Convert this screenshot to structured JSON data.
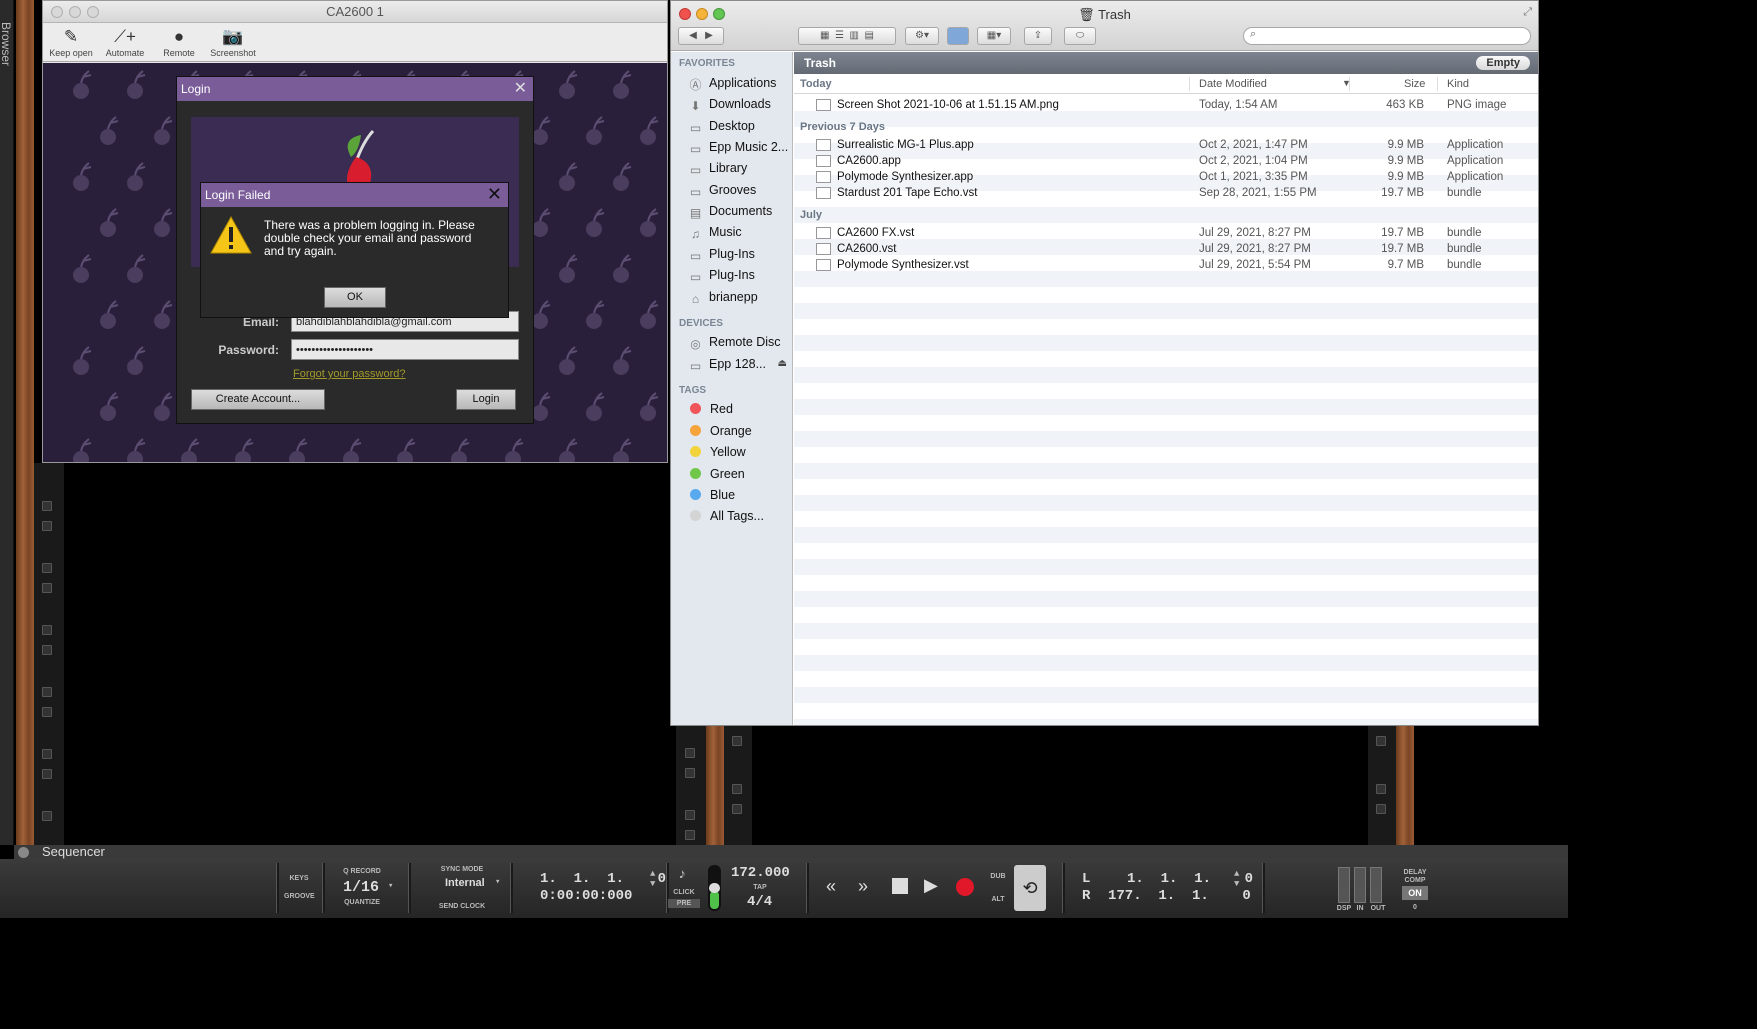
{
  "rack": {
    "browser_label": "Browser"
  },
  "ca_window": {
    "title": "CA2600 1",
    "toolbar": [
      {
        "label": "Keep open",
        "icon": "pin-icon"
      },
      {
        "label": "Automate",
        "icon": "automate-icon"
      },
      {
        "label": "Remote",
        "icon": "remote-icon"
      },
      {
        "label": "Screenshot",
        "icon": "camera-icon"
      }
    ]
  },
  "login": {
    "title": "Login",
    "email_label": "Email:",
    "email_value": "blahdiblahblahdibla@gmail.com",
    "password_label": "Password:",
    "password_value": "••••••••••••••••••••",
    "forgot": "Forgot your password?",
    "create_account": "Create Account...",
    "login_button": "Login"
  },
  "login_failed": {
    "title": "Login Failed",
    "message": "There was a problem logging in.  Please double check your email and password and try again.",
    "ok": "OK"
  },
  "finder": {
    "title": "Trash",
    "path": "Trash",
    "empty_button": "Empty",
    "sidebar": {
      "favorites_header": "FAVORITES",
      "favorites": [
        "Applications",
        "Downloads",
        "Desktop",
        "Epp Music 2...",
        "Library",
        "Grooves",
        "Documents",
        "Music",
        "Plug-Ins",
        "Plug-Ins",
        "brianepp"
      ],
      "devices_header": "DEVICES",
      "devices": [
        "Remote Disc",
        "Epp 128..."
      ],
      "tags_header": "TAGS",
      "tags": [
        {
          "name": "Red",
          "color": "#f0555a"
        },
        {
          "name": "Orange",
          "color": "#f5a33a"
        },
        {
          "name": "Yellow",
          "color": "#f2d43a"
        },
        {
          "name": "Green",
          "color": "#71c74a"
        },
        {
          "name": "Blue",
          "color": "#58a9ee"
        },
        {
          "name": "All Tags...",
          "color": "#d4d4d4"
        }
      ]
    },
    "columns": {
      "name": "Today",
      "date": "Date Modified",
      "size": "Size",
      "kind": "Kind"
    },
    "groups": [
      {
        "label": "Today",
        "rows": [
          {
            "name": "Screen Shot 2021-10-06 at 1.51.15 AM.png",
            "date": "Today, 1:54 AM",
            "size": "463 KB",
            "kind": "PNG image"
          }
        ]
      },
      {
        "label": "Previous 7 Days",
        "rows": [
          {
            "name": "Surrealistic MG-1 Plus.app",
            "date": "Oct 2, 2021, 1:47 PM",
            "size": "9.9 MB",
            "kind": "Application"
          },
          {
            "name": "CA2600.app",
            "date": "Oct 2, 2021, 1:04 PM",
            "size": "9.9 MB",
            "kind": "Application"
          },
          {
            "name": "Polymode Synthesizer.app",
            "date": "Oct 1, 2021, 3:35 PM",
            "size": "9.9 MB",
            "kind": "Application"
          },
          {
            "name": "Stardust 201 Tape Echo.vst",
            "date": "Sep 28, 2021, 1:55 PM",
            "size": "19.7 MB",
            "kind": "bundle"
          }
        ]
      },
      {
        "label": "July",
        "rows": [
          {
            "name": "CA2600 FX.vst",
            "date": "Jul 29, 2021, 8:27 PM",
            "size": "19.7 MB",
            "kind": "bundle"
          },
          {
            "name": "CA2600.vst",
            "date": "Jul 29, 2021, 8:27 PM",
            "size": "19.7 MB",
            "kind": "bundle"
          },
          {
            "name": "Polymode Synthesizer.vst",
            "date": "Jul 29, 2021, 5:54 PM",
            "size": "9.7 MB",
            "kind": "bundle"
          }
        ]
      }
    ]
  },
  "sequencer": {
    "label": "Sequencer"
  },
  "transport": {
    "keys": "KEYS",
    "groove": "GROOVE",
    "q_record": "Q RECORD",
    "quantize_value": "1/16",
    "quantize": "QUANTIZE",
    "sync_mode": "SYNC MODE",
    "sync_value": "Internal",
    "send_clock": "SEND CLOCK",
    "position_bars": "1.  1.  1.    0",
    "position_time": "0:00:00:000",
    "click": "CLICK",
    "pre": "PRE",
    "tempo": "172.000",
    "tap": "TAP",
    "signature": "4/4",
    "dub": "DUB",
    "alt": "ALT",
    "loop_l_label": "L",
    "loop_l": "1.  1.  1.    0",
    "loop_r_label": "R",
    "loop_r": "177.  1.  1.    0",
    "dsp": "DSP",
    "in": "IN",
    "out": "OUT",
    "delay_comp": "DELAY COMP",
    "on": "ON",
    "delay_value": "0"
  }
}
